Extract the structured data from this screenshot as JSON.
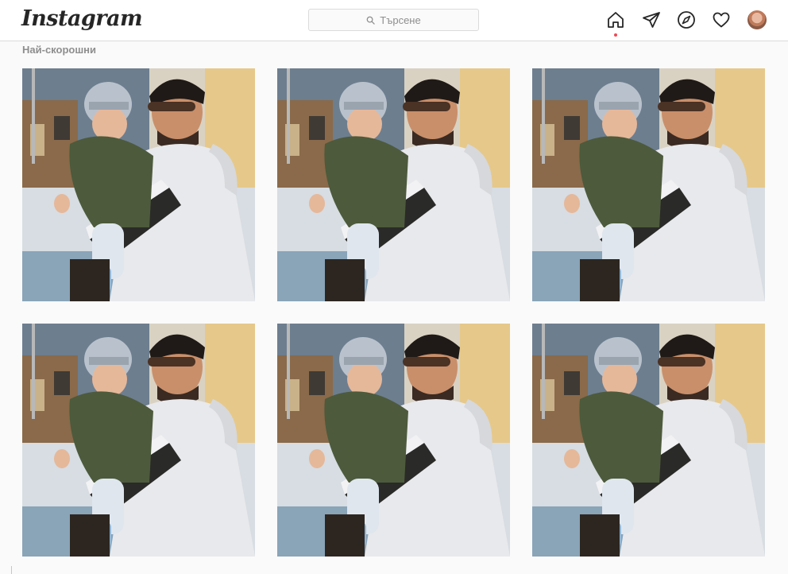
{
  "app": {
    "logo_text": "Instagram"
  },
  "search": {
    "placeholder": "Търсене"
  },
  "nav": {
    "icons": [
      "home-icon",
      "direct-message-icon",
      "explore-icon",
      "activity-heart-icon",
      "profile-avatar"
    ],
    "active": "home-icon",
    "notification_dot_color": "#ed4956"
  },
  "feed": {
    "section_title": "Най-скорошни",
    "posts": [
      {
        "description": "photo"
      },
      {
        "description": "photo"
      },
      {
        "description": "photo"
      },
      {
        "description": "photo"
      },
      {
        "description": "photo"
      },
      {
        "description": "photo"
      }
    ]
  }
}
